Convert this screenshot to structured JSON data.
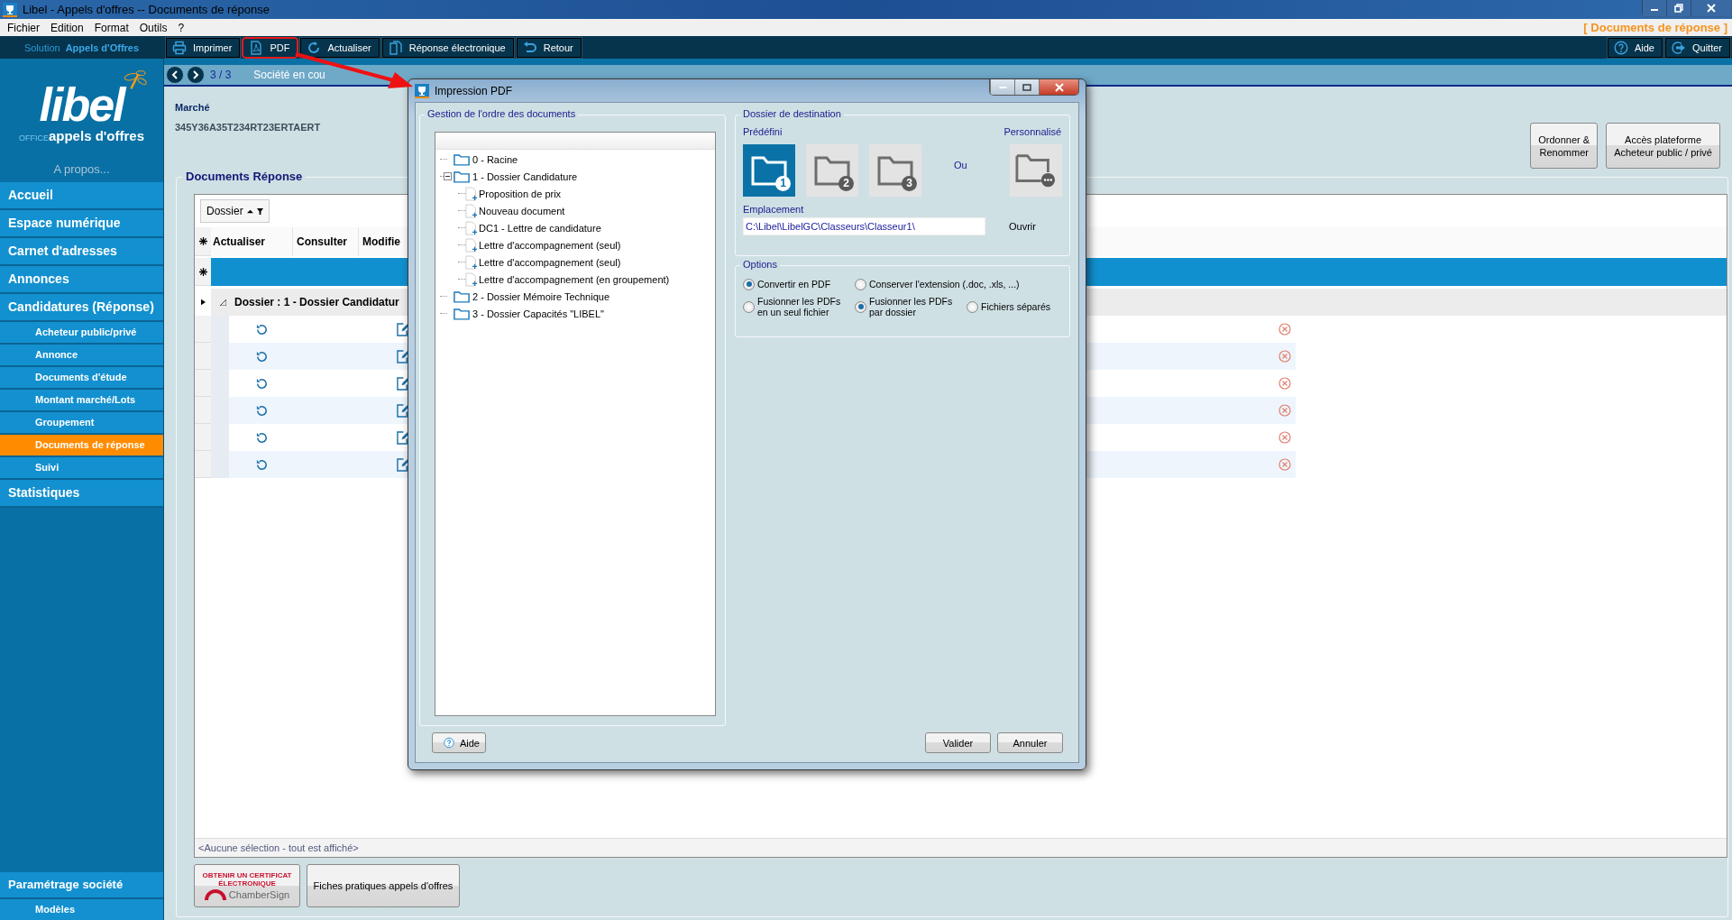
{
  "window": {
    "title": "Libel - Appels d'offres -- Documents de réponse"
  },
  "menu": [
    "Fichier",
    "Edition",
    "Format",
    "Outils",
    "?"
  ],
  "breadcrumb": "[ Documents de réponse ]",
  "toolbar": {
    "solution_label": "Solution",
    "solution_name": "Appels d'Offres",
    "buttons": [
      {
        "label": "Imprimer",
        "kind": "print",
        "highlighted": false
      },
      {
        "label": "PDF",
        "kind": "pdf",
        "highlighted": true
      },
      {
        "label": "Actualiser",
        "kind": "refresh",
        "highlighted": false
      },
      {
        "label": "Réponse électronique",
        "kind": "document",
        "highlighted": false
      },
      {
        "label": "Retour",
        "kind": "back",
        "highlighted": false
      }
    ],
    "right_buttons": [
      {
        "label": "Aide",
        "kind": "help"
      },
      {
        "label": "Quitter",
        "kind": "quit"
      }
    ]
  },
  "sidebar": {
    "logo": {
      "name": "libel",
      "prefix": "OFFICE",
      "tagline": "appels d'offres"
    },
    "about": "A propos...",
    "items": [
      {
        "label": "Accueil",
        "selected": false
      },
      {
        "label": "Espace numérique",
        "selected": false
      },
      {
        "label": "Carnet d'adresses",
        "selected": false
      },
      {
        "label": "Annonces",
        "selected": false
      },
      {
        "label": "Candidatures  (Réponse)",
        "selected": false,
        "children": [
          {
            "label": "Acheteur public/privé",
            "selected": false
          },
          {
            "label": "Annonce",
            "selected": false
          },
          {
            "label": "Documents d'étude",
            "selected": false
          },
          {
            "label": "Montant marché/Lots",
            "selected": false
          },
          {
            "label": "Groupement",
            "selected": false
          },
          {
            "label": "Documents de réponse",
            "selected": true
          },
          {
            "label": "Suivi",
            "selected": false
          }
        ]
      },
      {
        "label": "Statistiques",
        "selected": false
      }
    ],
    "bottom_items": [
      {
        "label": "Paramétrage société",
        "selected": false,
        "children": [
          {
            "label": "Modèles",
            "selected": false
          }
        ]
      }
    ]
  },
  "record_nav": {
    "position": "3 / 3",
    "company": "Société en cou"
  },
  "marche": {
    "label": "Marché",
    "value": "345Y36A35T234RT23ERTAERT"
  },
  "actions": [
    "Ordonner &\nRenommer",
    "Accès plateforme\nAcheteur public / privé"
  ],
  "documents": {
    "title": "Documents Réponse",
    "group_by": "Dossier",
    "columns": [
      "Actualiser",
      "Consulter",
      "Modifie"
    ],
    "group_row": "Dossier : 1 - Dossier Candidatur",
    "rows": [
      {
        "kind": "document"
      },
      {
        "kind": "document"
      },
      {
        "kind": "document"
      },
      {
        "kind": "document"
      },
      {
        "kind": "document"
      },
      {
        "kind": "document"
      }
    ],
    "footer": "<Aucune sélection - tout est affiché>"
  },
  "certificate_button": {
    "lines": [
      "OBTENIR UN CERTIFICAT",
      "ÉLECTRONIQUE"
    ],
    "brand": "ChamberSign"
  },
  "guide_button": "Fiches pratiques appels d'offres",
  "dialog": {
    "title": "Impression PDF",
    "order_title": "Gestion de l'ordre des documents",
    "tree": [
      {
        "label": "0 - Racine",
        "kind": "folder"
      },
      {
        "label": "1 - Dossier Candidature",
        "kind": "folder",
        "expanded": true,
        "children": [
          {
            "label": "Proposition de prix",
            "kind": "document"
          },
          {
            "label": "Nouveau document",
            "kind": "document"
          },
          {
            "label": "DC1 - Lettre de candidature",
            "kind": "document"
          },
          {
            "label": "Lettre d'accompagnement (seul)",
            "kind": "document"
          },
          {
            "label": "Lettre d'accompagnement (seul)",
            "kind": "document"
          },
          {
            "label": "Lettre d'accompagnement (en groupement)",
            "kind": "document"
          }
        ]
      },
      {
        "label": "2 - Dossier Mémoire Technique",
        "kind": "folder"
      },
      {
        "label": "3 - Dossier Capacités \"LIBEL\"",
        "kind": "folder"
      }
    ],
    "destination_title": "Dossier de destination",
    "predefined_label": "Prédéfini",
    "custom_label": "Personnalisé",
    "or": "Ou",
    "folders": [
      {
        "badge": "1",
        "selected": true
      },
      {
        "badge": "2",
        "selected": false
      },
      {
        "badge": "3",
        "selected": false
      }
    ],
    "location_label": "Emplacement",
    "location": "C:\\Libel\\LibelGC\\Classeurs\\Classeur1\\",
    "open": "Ouvrir",
    "options_title": "Options",
    "option_groups": [
      {
        "options": [
          {
            "label": "Convertir en PDF",
            "selected": true
          },
          {
            "label": "Conserver l'extension (.doc, .xls, ...)",
            "selected": false
          }
        ]
      },
      {
        "options": [
          {
            "label": "Fusionner les PDFs\nen un seul fichier",
            "selected": false
          },
          {
            "label": "Fusionner les PDFs\npar dossier",
            "selected": true
          },
          {
            "label": "Fichiers séparés",
            "selected": false
          }
        ]
      }
    ],
    "help_button": "Aide",
    "buttons": [
      "Valider",
      "Annuler"
    ]
  }
}
